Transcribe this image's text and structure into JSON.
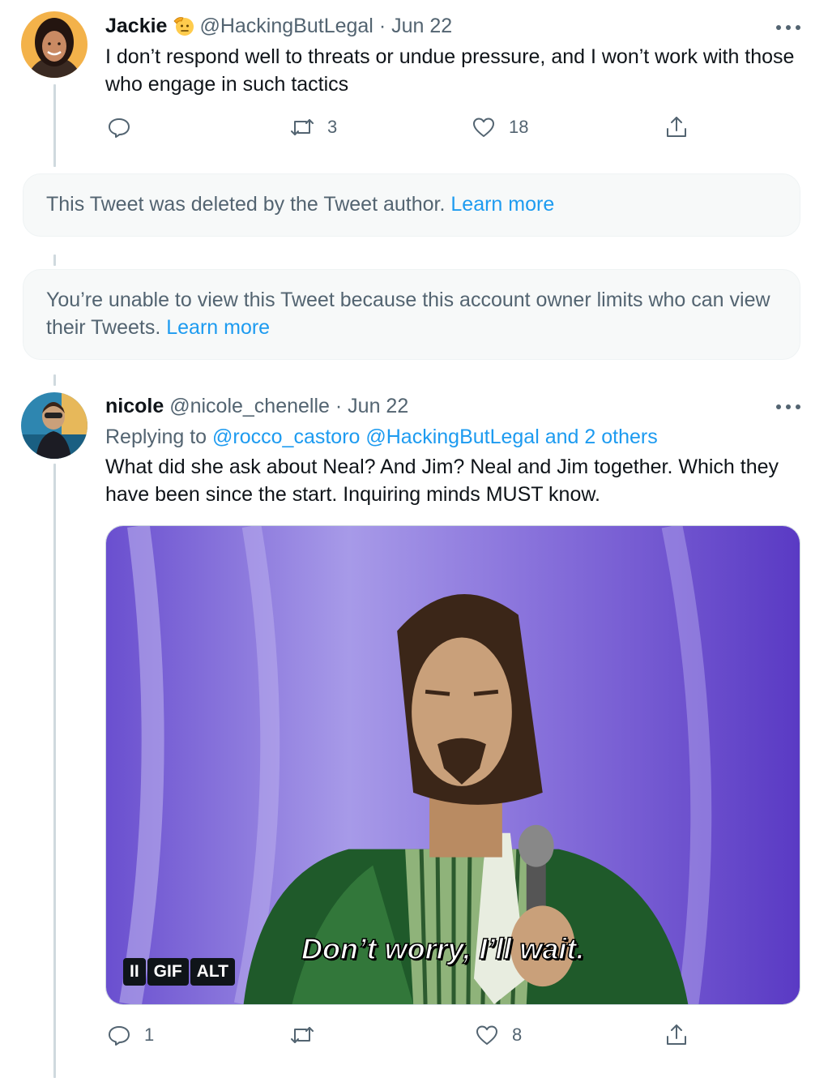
{
  "tweets": [
    {
      "name": "Jackie",
      "handle": "@HackingButLegal",
      "separator": "·",
      "date": "Jun 22",
      "text": "I don’t respond well to threats or undue pressure, and I won’t work with those who engage in such tactics",
      "reply_count": "",
      "retweet_count": "3",
      "like_count": "18"
    },
    {
      "name": "nicole",
      "handle": "@nicole_chenelle",
      "separator": "·",
      "date": "Jun 22",
      "replying_prefix": "Replying to",
      "replying_mentions": "@rocco_castoro @HackingButLegal and 2 others",
      "text": "What did she ask about Neal? And Jim? Neal and Jim together. Which they have been since the start. Inquiring minds MUST know.",
      "reply_count": "1",
      "retweet_count": "",
      "like_count": "8",
      "media": {
        "caption": "Don’t worry, I’ll wait.",
        "pause_label": "II",
        "gif_label": "GIF",
        "alt_label": "ALT"
      }
    }
  ],
  "notices": [
    {
      "text": "This Tweet was deleted by the Tweet author.",
      "link": "Learn more"
    },
    {
      "text": "You’re unable to view this Tweet because this account owner limits who can view their Tweets.",
      "link": "Learn more"
    }
  ],
  "colors": {
    "link": "#1d9bf0",
    "secondary_text": "#536471",
    "primary_text": "#0f1419"
  }
}
